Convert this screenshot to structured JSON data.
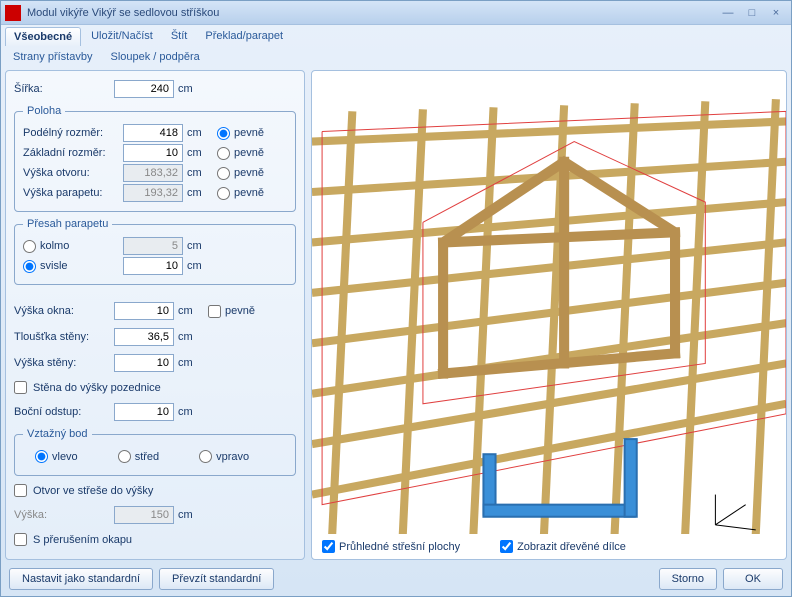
{
  "window": {
    "title": "Modul vikýře Vikýř se sedlovou stříškou"
  },
  "tabs1": [
    "Všeobecné",
    "Uložit/Načíst",
    "Štít",
    "Překlad/parapet"
  ],
  "tabs1_active": 0,
  "tabs2": [
    "Strany přístavby",
    "Sloupek / podpěra"
  ],
  "tabs2_active": 0,
  "width_row": {
    "label": "Šířka:",
    "value": "240",
    "unit": "cm"
  },
  "poloha": {
    "legend": "Poloha",
    "rows": [
      {
        "label": "Podélný rozměr:",
        "value": "418",
        "unit": "cm",
        "radio": "pevně",
        "disabled": false,
        "checked": true
      },
      {
        "label": "Základní rozměr:",
        "value": "10",
        "unit": "cm",
        "radio": "pevně",
        "disabled": false,
        "checked": false
      },
      {
        "label": "Výška otvoru:",
        "value": "183,32",
        "unit": "cm",
        "radio": "pevně",
        "disabled": true,
        "checked": false
      },
      {
        "label": "Výška parapetu:",
        "value": "193,32",
        "unit": "cm",
        "radio": "pevně",
        "disabled": true,
        "checked": false
      }
    ]
  },
  "presah": {
    "legend": "Přesah parapetu",
    "rows": [
      {
        "label": "kolmo",
        "value": "5",
        "unit": "cm",
        "disabled": true,
        "checked": false
      },
      {
        "label": "svisle",
        "value": "10",
        "unit": "cm",
        "disabled": false,
        "checked": true
      }
    ]
  },
  "mid_rows": [
    {
      "label": "Výška okna:",
      "value": "10",
      "unit": "cm",
      "chk": "pevně"
    },
    {
      "label": "Tloušťka stěny:",
      "value": "36,5",
      "unit": "cm"
    },
    {
      "label": "Výška stěny:",
      "value": "10",
      "unit": "cm"
    }
  ],
  "stena_chk": "Stěna do výšky pozednice",
  "bocni": {
    "label": "Boční odstup:",
    "value": "10",
    "unit": "cm"
  },
  "vztazny": {
    "legend": "Vztažný bod",
    "options": [
      "vlevo",
      "střed",
      "vpravo"
    ],
    "checked": 0
  },
  "otvor_chk": "Otvor ve střeše do výšky",
  "vyska_row": {
    "label": "Výška:",
    "value": "150",
    "unit": "cm"
  },
  "preruseni_chk": "S přerušením okapu",
  "viewport_checks": [
    "Průhledné střešní plochy",
    "Zobrazit dřevěné dílce"
  ],
  "footer": {
    "std_set": "Nastavit jako standardní",
    "std_take": "Převzít standardní",
    "cancel": "Storno",
    "ok": "OK"
  }
}
